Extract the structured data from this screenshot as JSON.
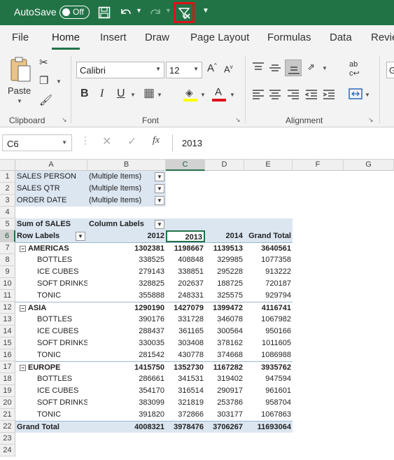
{
  "titlebar": {
    "autosave_label": "AutoSave",
    "toggle_state": "Off"
  },
  "tabs": [
    "File",
    "Home",
    "Insert",
    "Draw",
    "Page Layout",
    "Formulas",
    "Data",
    "Revie"
  ],
  "ribbon": {
    "paste_label": "Paste",
    "font_name": "Calibri",
    "font_size": "12",
    "groups": {
      "clipboard": "Clipboard",
      "font": "Font",
      "alignment": "Alignment"
    }
  },
  "formula_bar": {
    "name_box": "C6",
    "fx": "fx",
    "value": "2013"
  },
  "columns": [
    "A",
    "B",
    "C",
    "D",
    "E",
    "F",
    "G"
  ],
  "rows": [
    "1",
    "2",
    "3",
    "4",
    "5",
    "6",
    "7",
    "8",
    "9",
    "10",
    "11",
    "12",
    "13",
    "14",
    "15",
    "16",
    "17",
    "18",
    "19",
    "20",
    "21",
    "22",
    "23",
    "24"
  ],
  "filters": [
    {
      "field": "SALES PERSON",
      "value": "(Multiple Items)"
    },
    {
      "field": "SALES QTR",
      "value": "(Multiple Items)"
    },
    {
      "field": "ORDER DATE",
      "value": "(Multiple Items)"
    }
  ],
  "pivot": {
    "values_label": "Sum of SALES",
    "column_labels": "Column Labels",
    "row_labels": "Row Labels",
    "years": [
      "2012",
      "2013",
      "2014"
    ],
    "grand_total_header": "Grand Total",
    "groups": [
      {
        "name": "AMERICAS",
        "values": [
          "1302381",
          "1198667",
          "1139513",
          "3640561"
        ],
        "items": [
          {
            "name": "BOTTLES",
            "values": [
              "338525",
              "408848",
              "329985",
              "1077358"
            ]
          },
          {
            "name": "ICE CUBES",
            "values": [
              "279143",
              "338851",
              "295228",
              "913222"
            ]
          },
          {
            "name": "SOFT DRINKS",
            "values": [
              "328825",
              "202637",
              "188725",
              "720187"
            ]
          },
          {
            "name": "TONIC",
            "values": [
              "355888",
              "248331",
              "325575",
              "929794"
            ]
          }
        ]
      },
      {
        "name": "ASIA",
        "values": [
          "1290190",
          "1427079",
          "1399472",
          "4116741"
        ],
        "items": [
          {
            "name": "BOTTLES",
            "values": [
              "390176",
              "331728",
              "346078",
              "1067982"
            ]
          },
          {
            "name": "ICE CUBES",
            "values": [
              "288437",
              "361165",
              "300564",
              "950166"
            ]
          },
          {
            "name": "SOFT DRINKS",
            "values": [
              "330035",
              "303408",
              "378162",
              "1011605"
            ]
          },
          {
            "name": "TONIC",
            "values": [
              "281542",
              "430778",
              "374668",
              "1086988"
            ]
          }
        ]
      },
      {
        "name": "EUROPE",
        "values": [
          "1415750",
          "1352730",
          "1167282",
          "3935762"
        ],
        "items": [
          {
            "name": "BOTTLES",
            "values": [
              "286661",
              "341531",
              "319402",
              "947594"
            ]
          },
          {
            "name": "ICE CUBES",
            "values": [
              "354170",
              "316514",
              "290917",
              "961601"
            ]
          },
          {
            "name": "SOFT DRINKS",
            "values": [
              "383099",
              "321819",
              "253786",
              "958704"
            ]
          },
          {
            "name": "TONIC",
            "values": [
              "391820",
              "372866",
              "303177",
              "1067863"
            ]
          }
        ]
      }
    ],
    "grand_total": {
      "label": "Grand Total",
      "values": [
        "4008321",
        "3978476",
        "3706267",
        "11693064"
      ]
    }
  }
}
